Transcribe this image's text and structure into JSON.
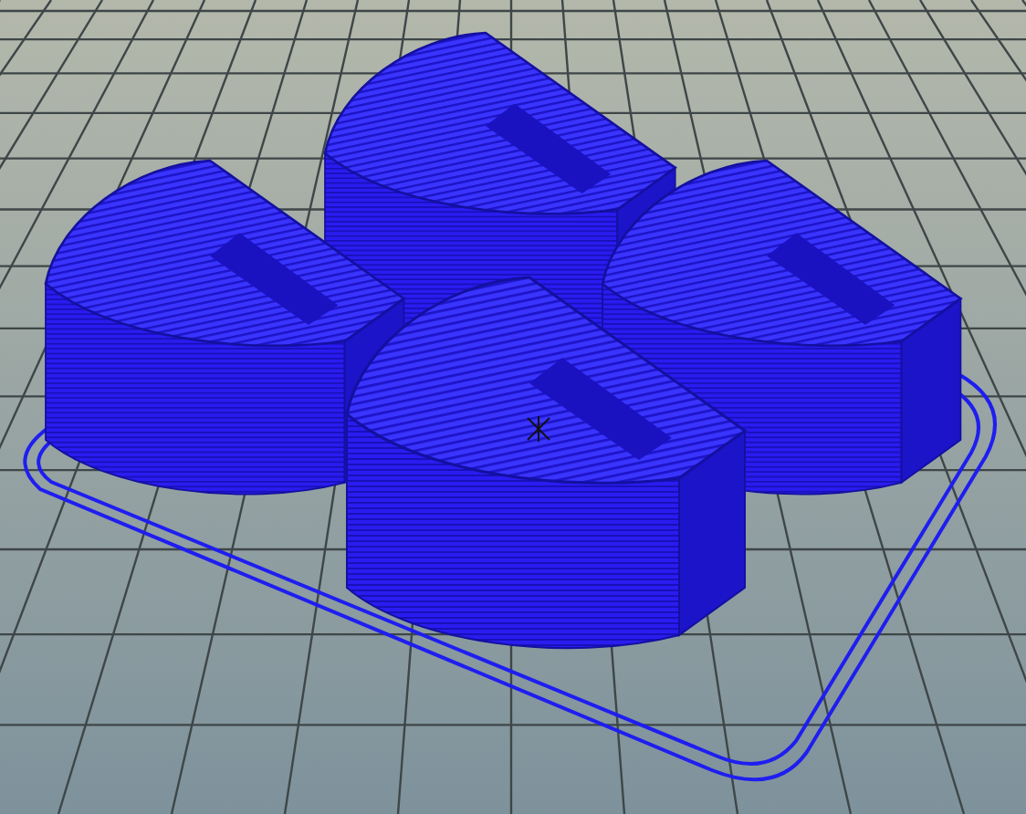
{
  "viewport": {
    "objects": [
      {
        "kind": "block"
      },
      {
        "kind": "block"
      },
      {
        "kind": "block"
      },
      {
        "kind": "block"
      }
    ]
  }
}
